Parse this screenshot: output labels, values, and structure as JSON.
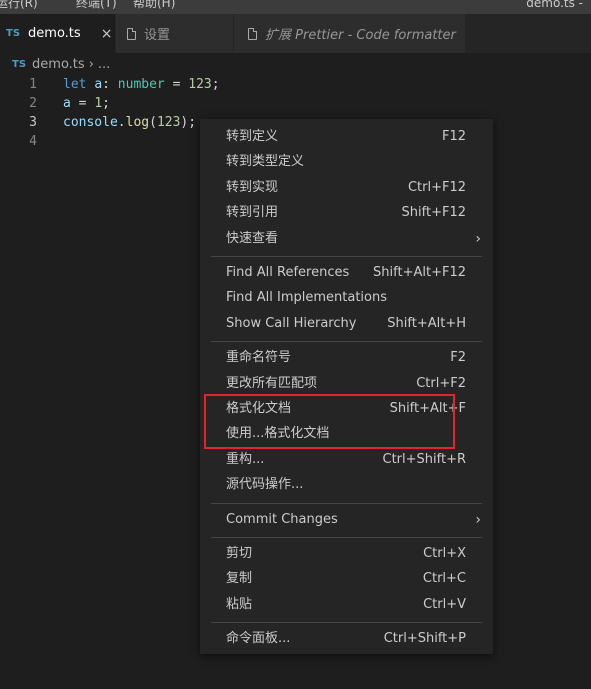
{
  "menubar": {
    "items": [
      "运行(R)",
      "终端(T)",
      "帮助(H)"
    ],
    "window_title": "demo.ts - "
  },
  "tabs": [
    {
      "badge": "TS",
      "label": "demo.ts",
      "close": "×"
    },
    {
      "label": "设置"
    },
    {
      "label": "扩展 Prettier - Code formatter"
    }
  ],
  "breadcrumb": {
    "badge": "TS",
    "file": "demo.ts",
    "sep": "›",
    "more": "..."
  },
  "editor": {
    "lines": [
      {
        "number": "1",
        "tokens": [
          [
            "kw",
            "let"
          ],
          [
            "punc",
            " "
          ],
          [
            "var",
            "a"
          ],
          [
            "punc",
            ": "
          ],
          [
            "type",
            "number"
          ],
          [
            "punc",
            " = "
          ],
          [
            "num",
            "123"
          ],
          [
            "punc",
            ";"
          ]
        ]
      },
      {
        "number": "2",
        "tokens": [
          [
            "var",
            "a"
          ],
          [
            "punc",
            " = "
          ],
          [
            "num",
            "1"
          ],
          [
            "punc",
            ";"
          ]
        ]
      },
      {
        "number": "3",
        "tokens": [
          [
            "var",
            "console"
          ],
          [
            "punc",
            "."
          ],
          [
            "fn",
            "log"
          ],
          [
            "punc",
            "("
          ],
          [
            "num",
            "123"
          ],
          [
            "punc",
            ");"
          ]
        ]
      },
      {
        "number": "4",
        "tokens": []
      }
    ]
  },
  "context_menu": {
    "groups": [
      [
        {
          "label": "转到定义",
          "key": "F12"
        },
        {
          "label": "转到类型定义",
          "key": ""
        },
        {
          "label": "转到实现",
          "key": "Ctrl+F12"
        },
        {
          "label": "转到引用",
          "key": "Shift+F12"
        },
        {
          "label": "快速查看",
          "key": "",
          "submenu": true
        }
      ],
      [
        {
          "label": "Find All References",
          "key": "Shift+Alt+F12"
        },
        {
          "label": "Find All Implementations",
          "key": ""
        },
        {
          "label": "Show Call Hierarchy",
          "key": "Shift+Alt+H"
        }
      ],
      [
        {
          "label": "重命名符号",
          "key": "F2"
        },
        {
          "label": "更改所有匹配项",
          "key": "Ctrl+F2"
        },
        {
          "label": "格式化文档",
          "key": "Shift+Alt+F"
        },
        {
          "label": "使用...格式化文档",
          "key": ""
        },
        {
          "label": "重构...",
          "key": "Ctrl+Shift+R"
        },
        {
          "label": "源代码操作...",
          "key": ""
        }
      ],
      [
        {
          "label": "Commit Changes",
          "key": "",
          "submenu": true
        }
      ],
      [
        {
          "label": "剪切",
          "key": "Ctrl+X"
        },
        {
          "label": "复制",
          "key": "Ctrl+C"
        },
        {
          "label": "粘贴",
          "key": "Ctrl+V"
        }
      ],
      [
        {
          "label": "命令面板...",
          "key": "Ctrl+Shift+P"
        }
      ]
    ],
    "submenu_arrow": "›"
  },
  "colors": {
    "menu_bg": "#252526",
    "editor_bg": "#1e1e1e",
    "highlight": "#e0252c"
  }
}
